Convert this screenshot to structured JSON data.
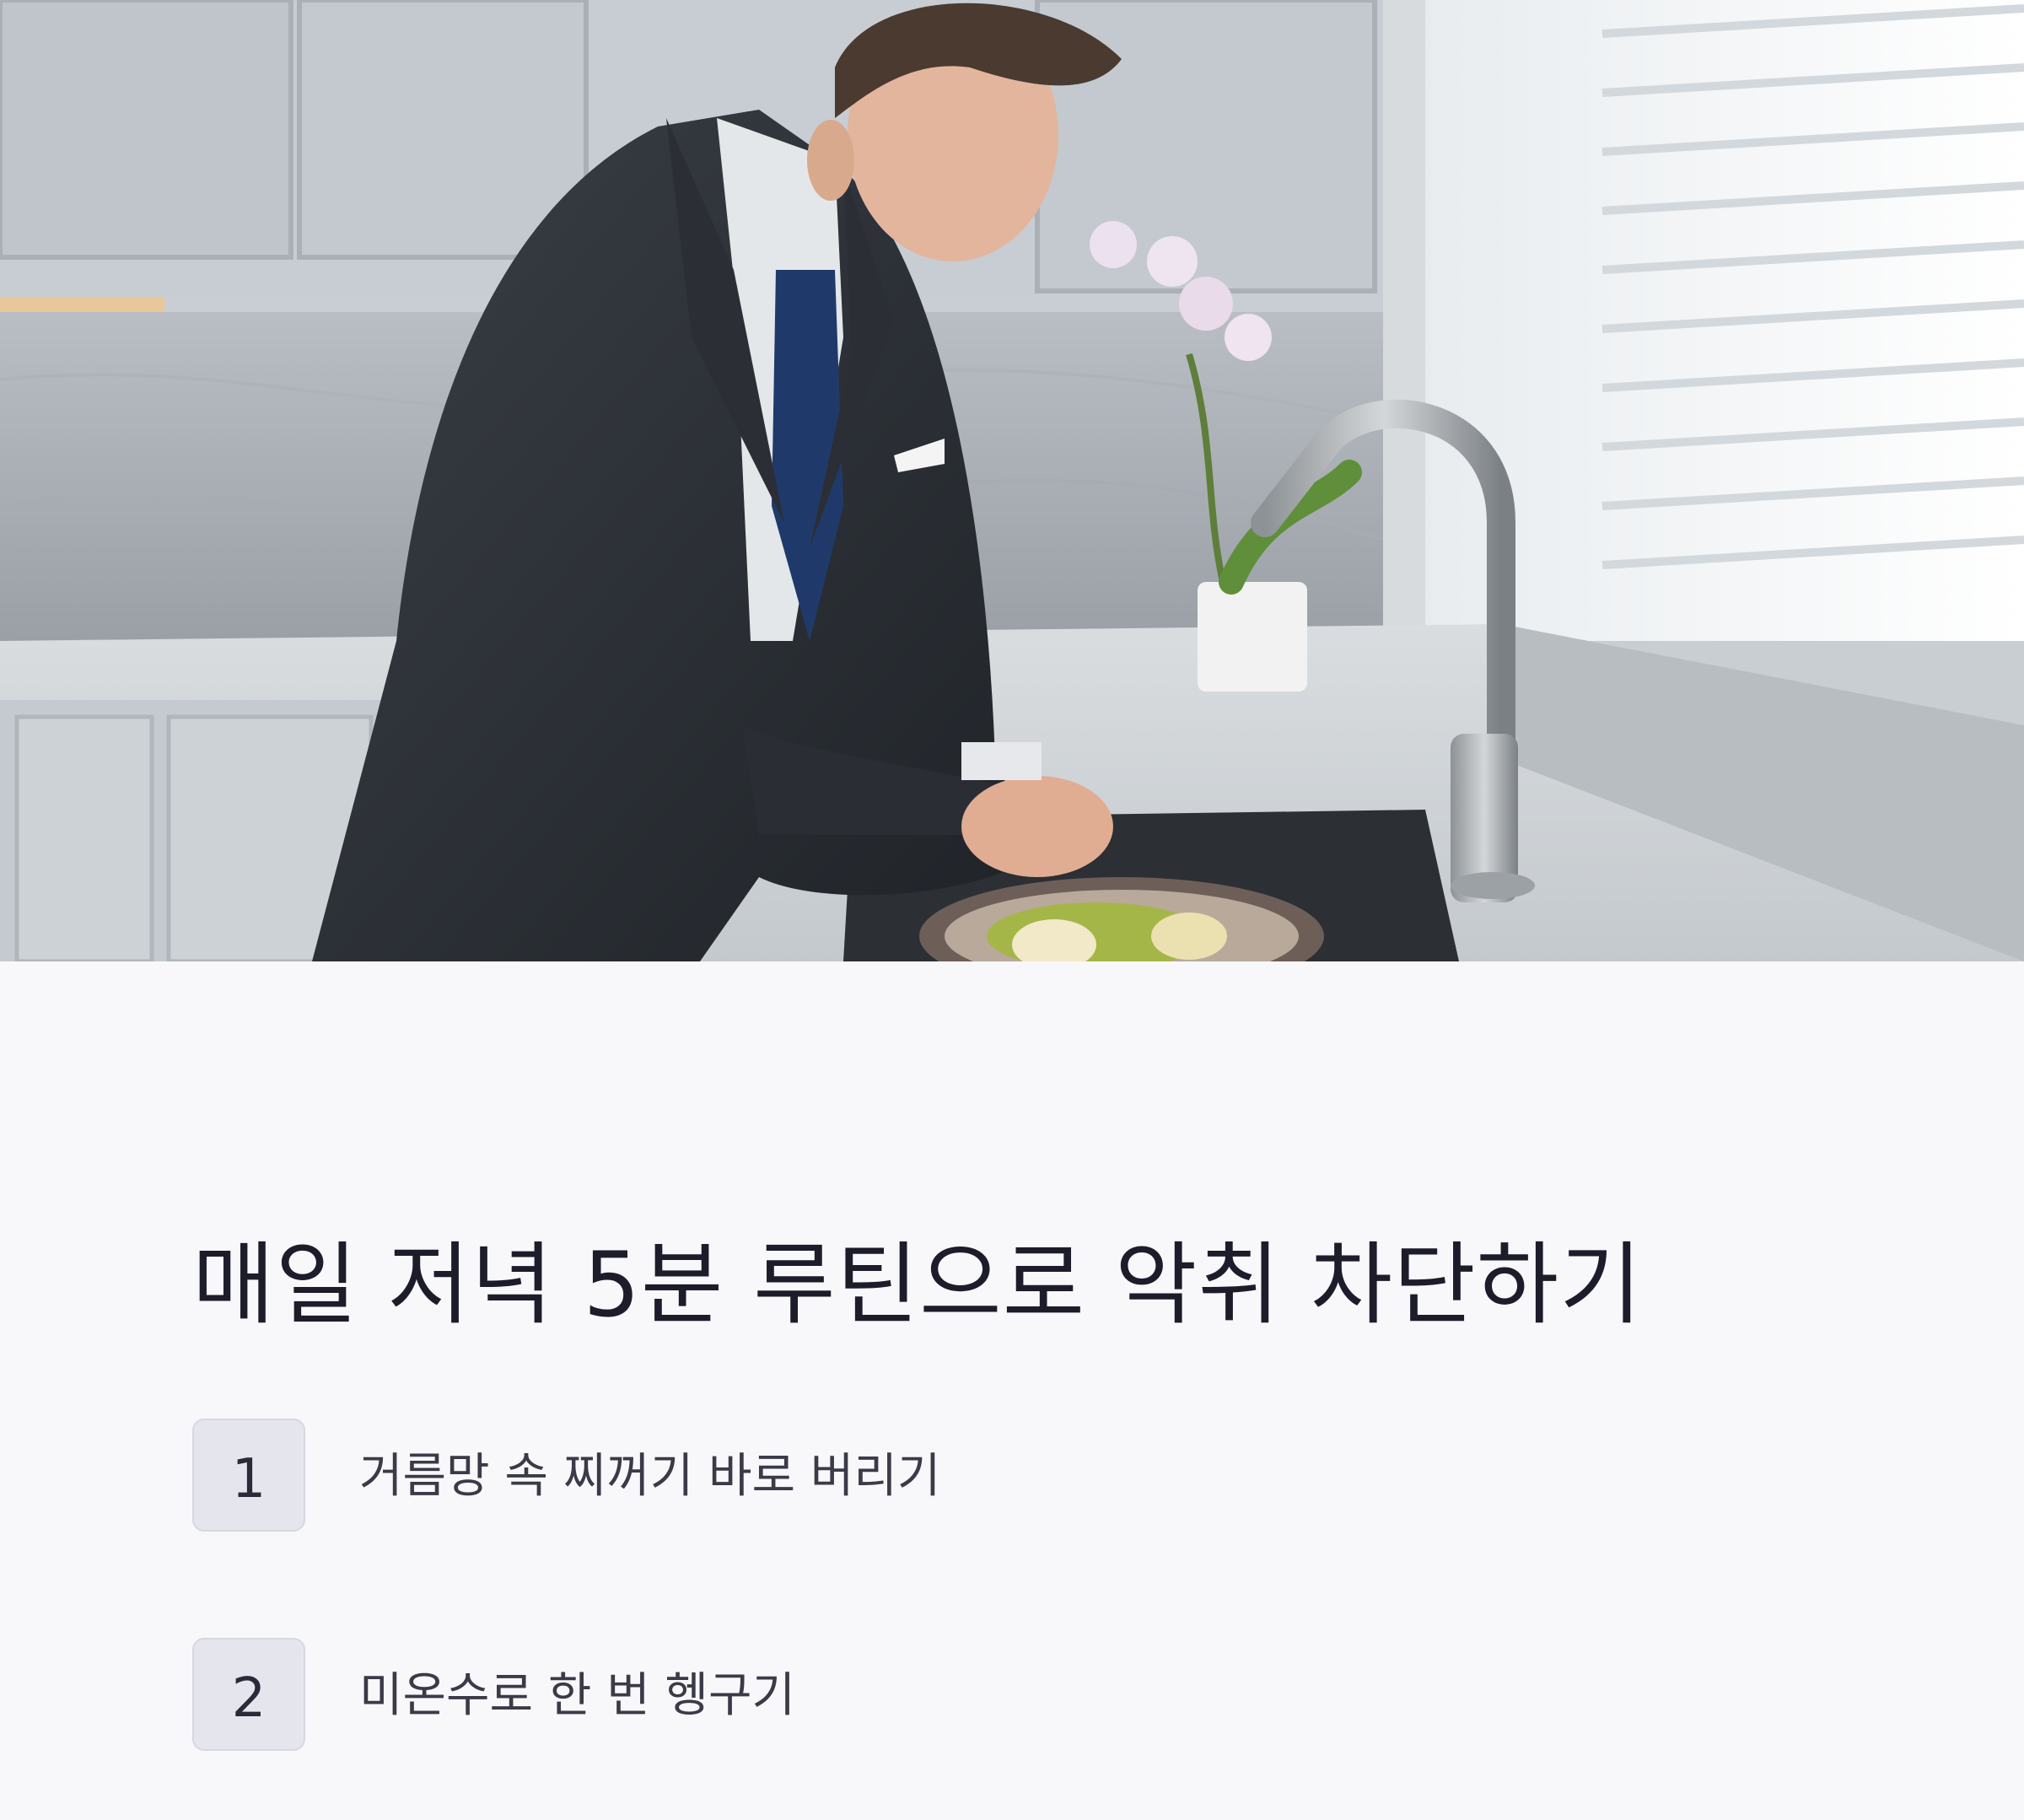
{
  "headline": "매일 저녁 5분 루틴으로 악취 차단하기",
  "steps": [
    {
      "number": "1",
      "text": "거름망 속 찌꺼기 바로 버리기"
    },
    {
      "number": "2",
      "text": "미온수로 한 번 헹구기"
    }
  ],
  "colors": {
    "background": "#f8f8fa",
    "headline": "#1c1c2b",
    "badge_fill": "#e5e5ed",
    "badge_border": "#d7d7e0",
    "body_text": "#3a3a48"
  }
}
